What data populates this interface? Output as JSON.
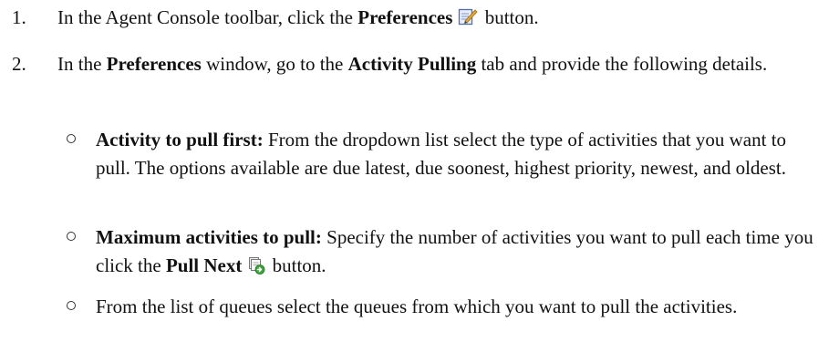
{
  "steps": [
    {
      "number": "1.",
      "t1": "In the Agent Console toolbar, click the ",
      "b1": "Preferences",
      "icon": "preferences-icon",
      "t2": " button."
    },
    {
      "number": "2.",
      "t1": "In the ",
      "b1": "Preferences",
      "t2": " window, go to the ",
      "b2": "Activity Pulling",
      "t3": " tab and provide the following details."
    }
  ],
  "subitems": [
    {
      "b1": "Activity to pull first:",
      "t1": " From the dropdown list select the type of activities that you want to pull. The options available are due latest, due soonest, highest priority, newest, and oldest."
    },
    {
      "b1": "Maximum activities to pull:",
      "t1": " Specify the number of activities you want to pull each time you click the ",
      "b2": "Pull Next",
      "icon": "pull-next-icon",
      "t2": " button."
    },
    {
      "t1": "From the list of queues select the queues from which you want to pull the activities."
    }
  ]
}
